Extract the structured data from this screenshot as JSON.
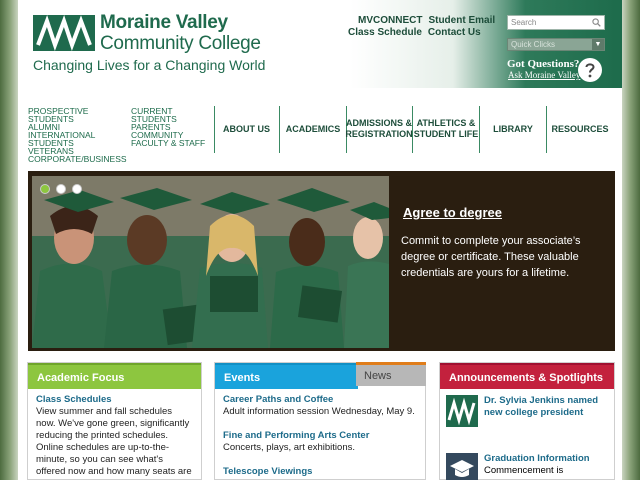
{
  "header": {
    "logo_line1": "Moraine Valley",
    "logo_line2": "Community College",
    "tagline": "Changing Lives for a Changing World",
    "toplinks_row1": [
      "MVCONNECT",
      "Student Email"
    ],
    "toplinks_row2": [
      "Class Schedule",
      "Contact Us"
    ],
    "search_placeholder": "Search",
    "quicklinks_label": "Quick Clicks",
    "got_questions": "Got Questions?",
    "ask_link": "Ask Moraine Valley"
  },
  "nav": {
    "audience_col1": [
      "PROSPECTIVE",
      "STUDENTS",
      "ALUMNI",
      "INTERNATIONAL",
      "STUDENTS",
      "VETERANS",
      "CORPORATE/BUSINESS"
    ],
    "audience_col2": [
      "CURRENT",
      "STUDENTS",
      "PARENTS",
      "COMMUNITY",
      "FACULTY & STAFF"
    ],
    "about": "ABOUT US",
    "academics": "ACADEMICS",
    "admissions": "ADMISSIONS & REGISTRATION",
    "athletics": "ATHLETICS & STUDENT LIFE",
    "library": "LIBRARY",
    "resources": "RESOURCES"
  },
  "hero": {
    "title": "Agree to degree",
    "text": "Commit to complete your associate’s degree or certificate. These valuable credentials are yours for a lifetime."
  },
  "academic_focus": {
    "heading": "Academic Focus",
    "item_title": "Class Schedules",
    "item_text": "View summer and fall schedules now. We've gone green, significantly reducing the printed schedules. Online schedules are up-to-the-minute, so you can see what's offered now and how many seats are"
  },
  "events": {
    "heading": "Events",
    "news_tab": "News",
    "items": [
      {
        "title": "Career Paths and Coffee",
        "text": "Adult information session Wednesday, May 9."
      },
      {
        "title": "Fine and Performing Arts Center",
        "text": "Concerts, plays, art exhibitions."
      },
      {
        "title": "Telescope Viewings",
        "text": ""
      }
    ]
  },
  "announcements": {
    "heading": "Announcements & Spotlights",
    "items": [
      {
        "title": "Dr. Sylvia Jenkins named new college president",
        "text": ""
      },
      {
        "title": "Graduation Information",
        "text": "Commencement is"
      }
    ]
  },
  "colors": {
    "brand_green": "#1f6a4d",
    "academic_green": "#8dc63f",
    "events_blue": "#1aa3dc",
    "announce_red": "#c3213d",
    "news_orange": "#e07d1a"
  }
}
